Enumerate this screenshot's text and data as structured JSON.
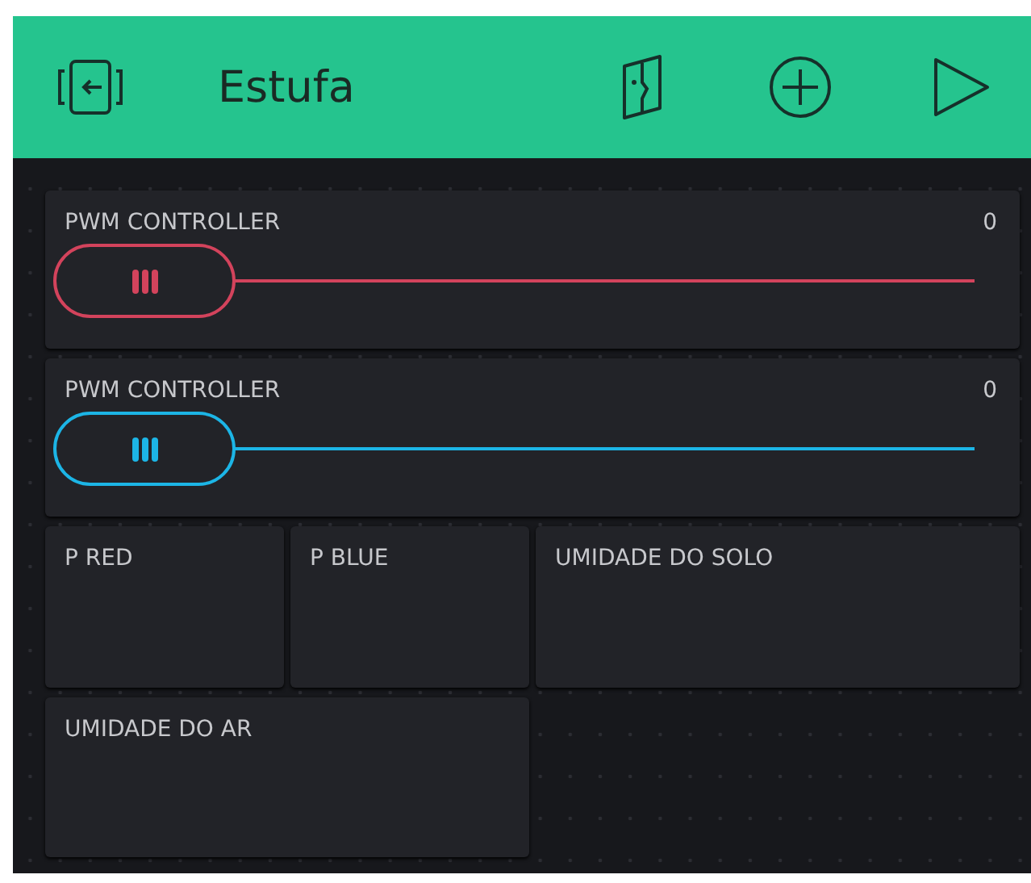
{
  "header": {
    "title": "Estufa"
  },
  "widgets": [
    {
      "kind": "slider",
      "label": "PWM CONTROLLER",
      "value": "0",
      "color": "#d3435c"
    },
    {
      "kind": "slider",
      "label": "PWM CONTROLLER",
      "value": "0",
      "color": "#1cb5e6"
    },
    {
      "kind": "small",
      "label": "P RED"
    },
    {
      "kind": "small",
      "label": "P BLUE"
    },
    {
      "kind": "wide",
      "label": "UMIDADE DO SOLO"
    },
    {
      "kind": "wide",
      "label": "UMIDADE DO AR"
    }
  ]
}
